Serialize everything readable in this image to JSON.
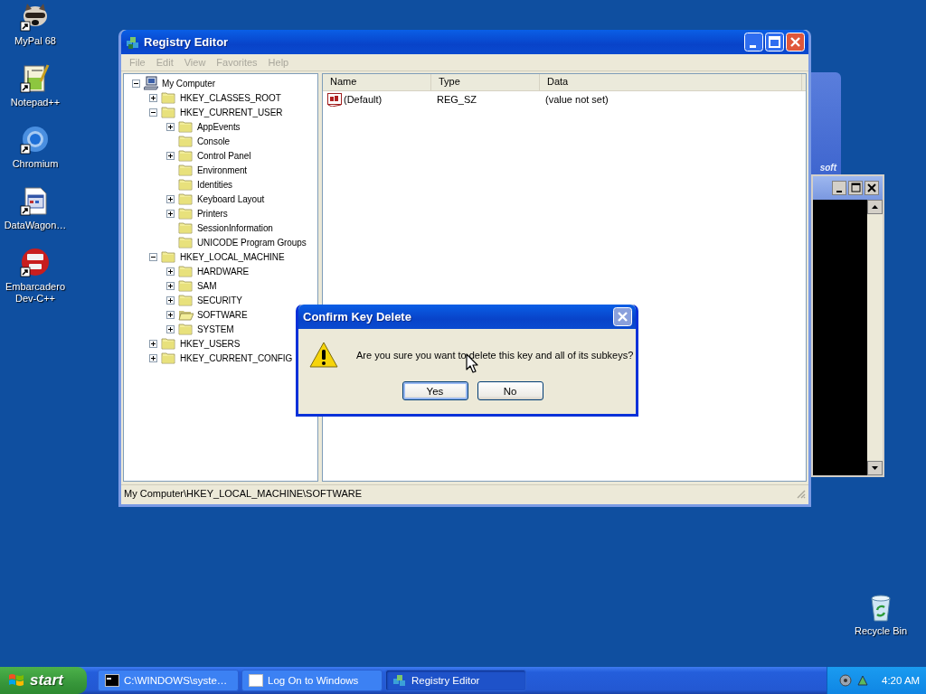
{
  "desktop_icons": [
    {
      "label": "MyPal 68",
      "kind": "raccoon"
    },
    {
      "label": "Notepad++",
      "kind": "notepad"
    },
    {
      "label": "Chromium",
      "kind": "browser"
    },
    {
      "label": "DataWagon…",
      "kind": "document"
    },
    {
      "label": "Embarcadero Dev-C++",
      "kind": "devcpp"
    }
  ],
  "recycle_bin": {
    "label": "Recycle Bin"
  },
  "logon_window": {
    "banner_text": "soft"
  },
  "registry_editor": {
    "title": "Registry Editor",
    "menu": [
      {
        "label": "File",
        "disabled": true
      },
      {
        "label": "Edit",
        "disabled": true
      },
      {
        "label": "View",
        "disabled": true
      },
      {
        "label": "Favorites",
        "disabled": true
      },
      {
        "label": "Help",
        "disabled": true
      }
    ],
    "tree": [
      {
        "label": "My Computer",
        "kind": "computer",
        "expanded": true,
        "selected": false,
        "children": [
          {
            "label": "HKEY_CLASSES_ROOT",
            "kind": "folder",
            "expanded": false,
            "selected": false
          },
          {
            "label": "HKEY_CURRENT_USER",
            "kind": "folder",
            "expanded": true,
            "selected": false,
            "children": [
              {
                "label": "AppEvents",
                "kind": "folder",
                "expanded": false,
                "selected": false
              },
              {
                "label": "Console",
                "kind": "folder",
                "selected": false
              },
              {
                "label": "Control Panel",
                "kind": "folder",
                "expanded": false,
                "selected": false
              },
              {
                "label": "Environment",
                "kind": "folder",
                "selected": false
              },
              {
                "label": "Identities",
                "kind": "folder",
                "selected": false
              },
              {
                "label": "Keyboard Layout",
                "kind": "folder",
                "expanded": false,
                "selected": false
              },
              {
                "label": "Printers",
                "kind": "folder",
                "expanded": false,
                "selected": false
              },
              {
                "label": "SessionInformation",
                "kind": "folder",
                "selected": false
              },
              {
                "label": "UNICODE Program Groups",
                "kind": "folder",
                "selected": false
              }
            ]
          },
          {
            "label": "HKEY_LOCAL_MACHINE",
            "kind": "folder",
            "expanded": true,
            "selected": false,
            "children": [
              {
                "label": "HARDWARE",
                "kind": "folder",
                "expanded": false,
                "selected": false
              },
              {
                "label": "SAM",
                "kind": "folder",
                "expanded": false,
                "selected": false
              },
              {
                "label": "SECURITY",
                "kind": "folder",
                "expanded": false,
                "selected": false
              },
              {
                "label": "SOFTWARE",
                "kind": "folder",
                "expanded": false,
                "selected": true
              },
              {
                "label": "SYSTEM",
                "kind": "folder",
                "expanded": false,
                "selected": false
              }
            ]
          },
          {
            "label": "HKEY_USERS",
            "kind": "folder",
            "expanded": false,
            "selected": false
          },
          {
            "label": "HKEY_CURRENT_CONFIG",
            "kind": "folder",
            "expanded": false,
            "selected": false
          }
        ]
      }
    ],
    "columns": [
      "Name",
      "Type",
      "Data"
    ],
    "rows": [
      {
        "name": "(Default)",
        "type": "REG_SZ",
        "data": "(value not set)"
      }
    ],
    "status_bar": "My Computer\\HKEY_LOCAL_MACHINE\\SOFTWARE"
  },
  "dialog": {
    "title": "Confirm Key Delete",
    "message": "Are you sure you want to delete this key and all of its subkeys?",
    "buttons": [
      {
        "label": "Yes",
        "default": true
      },
      {
        "label": "No",
        "default": false
      }
    ]
  },
  "taskbar": {
    "start": "start",
    "buttons": [
      {
        "label": "C:\\WINDOWS\\syste…",
        "kind": "console",
        "selected": false
      },
      {
        "label": "Log On to Windows",
        "kind": "window",
        "selected": false
      },
      {
        "label": "Registry Editor",
        "kind": "regedit",
        "selected": true
      }
    ],
    "clock": "4:20 AM"
  }
}
